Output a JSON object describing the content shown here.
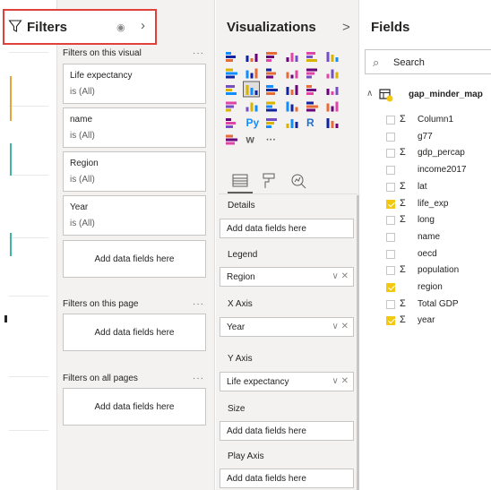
{
  "filters": {
    "title": "Filters",
    "on_visual_label": "Filters on this visual",
    "more": "···",
    "cards": [
      {
        "name": "Life expectancy",
        "value": "is (All)"
      },
      {
        "name": "name",
        "value": "is (All)"
      },
      {
        "name": "Region",
        "value": "is (All)"
      },
      {
        "name": "Year",
        "value": "is (All)"
      }
    ],
    "add_here": "Add data fields here",
    "on_page_label": "Filters on this page",
    "on_all_label": "Filters on all pages"
  },
  "visualizations": {
    "title": "Visualizations",
    "chevron": ">",
    "icons": [
      "stacked-bar",
      "stacked-column",
      "clustered-bar",
      "clustered-column",
      "100-bar",
      "100-column",
      "line",
      "area",
      "stacked-area",
      "line-column",
      "line-clustered",
      "ribbon",
      "waterfall",
      "scatter",
      "pie",
      "donut",
      "treemap",
      "map",
      "filled-map",
      "funnel",
      "gauge",
      "card",
      "multirow-card",
      "kpi",
      "slicer",
      "python",
      "table",
      "matrix",
      "r-visual",
      "key-influencers",
      "globe",
      "w",
      "more"
    ],
    "wells": {
      "details": "Details",
      "details_drop": "Add data fields here",
      "legend": "Legend",
      "legend_value": "Region",
      "xaxis": "X Axis",
      "xaxis_value": "Year",
      "yaxis": "Y Axis",
      "yaxis_value": "Life expectancy",
      "size": "Size",
      "size_drop": "Add data fields here",
      "play_axis": "Play Axis",
      "play_drop": "Add data fields here"
    }
  },
  "fields": {
    "title": "Fields",
    "search_placeholder": "Search",
    "table": "gap_minder_map",
    "items": [
      {
        "name": "Column1",
        "sigma": true,
        "checked": false
      },
      {
        "name": "g77",
        "sigma": false,
        "checked": false
      },
      {
        "name": "gdp_percap",
        "sigma": true,
        "checked": false
      },
      {
        "name": "income2017",
        "sigma": false,
        "checked": false
      },
      {
        "name": "lat",
        "sigma": true,
        "checked": false
      },
      {
        "name": "life_exp",
        "sigma": true,
        "checked": true
      },
      {
        "name": "long",
        "sigma": true,
        "checked": false
      },
      {
        "name": "name",
        "sigma": false,
        "checked": false
      },
      {
        "name": "oecd",
        "sigma": false,
        "checked": false
      },
      {
        "name": "population",
        "sigma": true,
        "checked": false
      },
      {
        "name": "region",
        "sigma": false,
        "checked": true
      },
      {
        "name": "Total GDP",
        "sigma": true,
        "checked": false
      },
      {
        "name": "year",
        "sigma": true,
        "checked": true
      }
    ]
  },
  "colors": {
    "accent": "#f2c811",
    "highlight_border": "#e0413a",
    "pane_bg": "#f3f2f1"
  }
}
